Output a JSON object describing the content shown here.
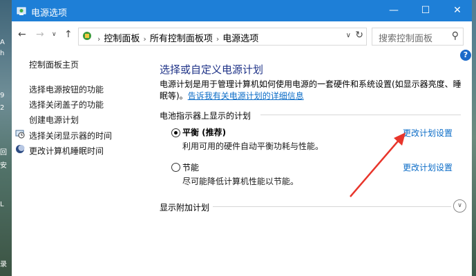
{
  "window": {
    "title": "电源选项",
    "controls": {
      "minimize": "—",
      "maximize": "☐",
      "close": "✕"
    }
  },
  "address_bar": {
    "crumbs": [
      "控制面板",
      "所有控制面板项",
      "电源选项"
    ],
    "search_placeholder": "搜索控制面板"
  },
  "sidebar": {
    "home": "控制面板主页",
    "links": [
      "选择电源按钮的功能",
      "选择关闭盖子的功能",
      "创建电源计划",
      "选择关闭显示器的时间",
      "更改计算机睡眠时间"
    ]
  },
  "main": {
    "heading": "选择或自定义电源计划",
    "description": "电源计划是用于管理计算机如何使用电源的一套硬件和系统设置(如显示器亮度、睡眠等)。",
    "description_link": "告诉我有关电源计划的详细信息",
    "group_label": "电池指示器上显示的计划",
    "plans": [
      {
        "name": "平衡 (推荐)",
        "description": "利用可用的硬件自动平衡功耗与性能。",
        "link": "更改计划设置",
        "selected": true
      },
      {
        "name": "节能",
        "description": "尽可能降低计算机性能以节能。",
        "link": "更改计划设置",
        "selected": false
      }
    ],
    "more_plans_label": "显示附加计划"
  },
  "desktop_edge_text": [
    "A",
    "h",
    "9",
    "2",
    "回",
    "安",
    "L",
    "录"
  ],
  "colors": {
    "titlebar": "#1e7fd7",
    "link": "#0b6cc7",
    "heading": "#1e3287",
    "annotation_arrow": "#e8352b"
  }
}
